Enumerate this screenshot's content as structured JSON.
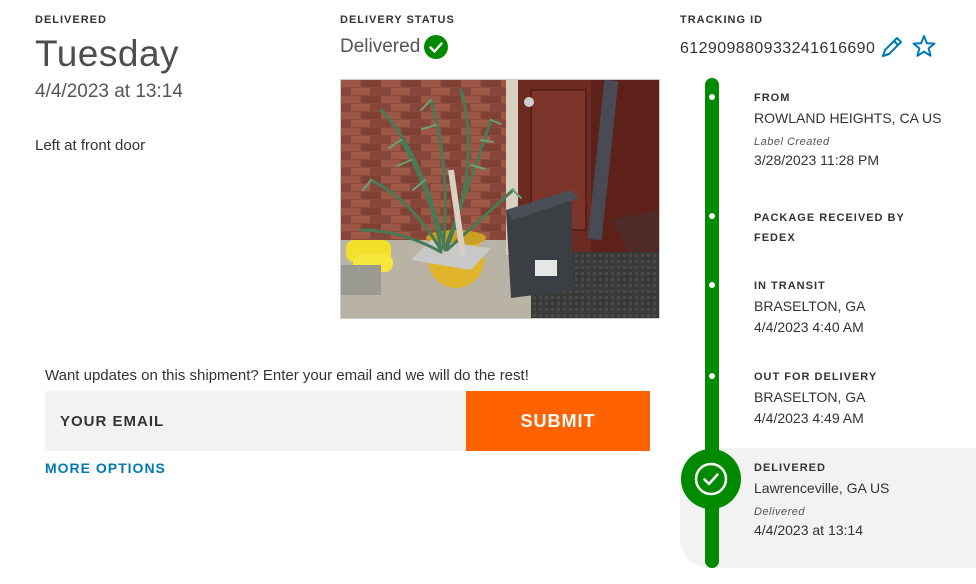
{
  "delivered_block": {
    "eyebrow": "DELIVERED",
    "day": "Tuesday",
    "datetime": "4/4/2023 at 13:14",
    "note": "Left at front door"
  },
  "status_block": {
    "eyebrow": "DELIVERY STATUS",
    "value": "Delivered"
  },
  "tracking_block": {
    "eyebrow": "TRACKING ID",
    "number": "612909880933241616690"
  },
  "updates": {
    "prompt": "Want updates on this shipment? Enter your email and we will do the rest!",
    "email_placeholder": "YOUR EMAIL",
    "submit_label": "SUBMIT",
    "more_options": "MORE OPTIONS"
  },
  "timeline": [
    {
      "title": "FROM",
      "location": "ROWLAND HEIGHTS, CA US",
      "sub": "Label Created",
      "time": "3/28/2023 11:28 PM"
    },
    {
      "title": "PACKAGE RECEIVED BY FEDEX",
      "location": "",
      "sub": "",
      "time": ""
    },
    {
      "title": "IN TRANSIT",
      "location": "BRASELTON, GA",
      "sub": "",
      "time": "4/4/2023 4:40 AM"
    },
    {
      "title": "OUT FOR DELIVERY",
      "location": "BRASELTON, GA",
      "sub": "",
      "time": "4/4/2023 4:49 AM"
    },
    {
      "title": "DELIVERED",
      "location": "Lawrenceville, GA US",
      "sub": "Delivered",
      "time": "4/4/2023 at 13:14"
    }
  ],
  "icons": {
    "status_check": "check-circle-icon",
    "edit": "pencil-icon",
    "watch": "star-icon",
    "delivered_check": "check-circle-icon"
  },
  "colors": {
    "brand_orange": "#ff6200",
    "link_blue": "#007ab7",
    "timeline_green": "#008a00",
    "panel_gray": "#f2f2f2"
  }
}
